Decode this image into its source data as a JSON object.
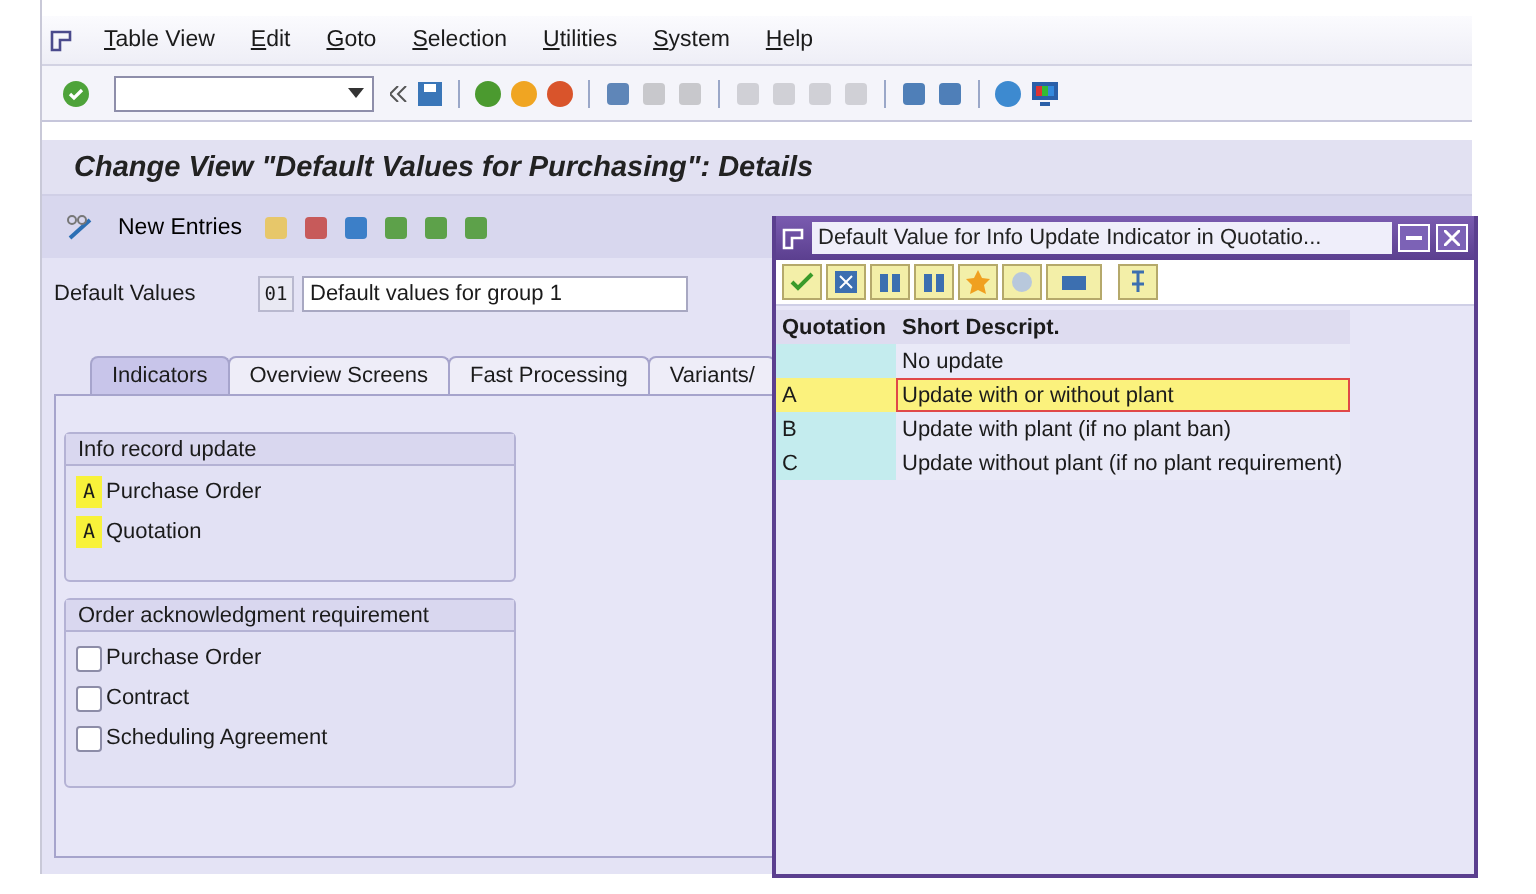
{
  "menu_bar": {
    "items": [
      "Table View",
      "Edit",
      "Goto",
      "Selection",
      "Utilities",
      "System",
      "Help"
    ]
  },
  "screen_title": "Change View \"Default Values for Purchasing\": Details",
  "app_toolbar": {
    "new_entries": "New Entries"
  },
  "default_values": {
    "label": "Default Values",
    "code": "01",
    "description": "Default values for group 1"
  },
  "tabs": [
    {
      "label": "Indicators",
      "selected": true
    },
    {
      "label": "Overview Screens",
      "selected": false
    },
    {
      "label": "Fast Processing",
      "selected": false
    },
    {
      "label": "Variants/",
      "selected": false
    }
  ],
  "groups": [
    {
      "title": "Info record update",
      "items": [
        {
          "kind": "indicator",
          "value": "A",
          "label": "Purchase Order",
          "highlighted": true
        },
        {
          "kind": "indicator",
          "value": "A",
          "label": "Quotation",
          "highlighted": true
        }
      ]
    },
    {
      "title": "Order acknowledgment requirement",
      "items": [
        {
          "kind": "checkbox",
          "checked": false,
          "label": "Purchase Order"
        },
        {
          "kind": "checkbox",
          "checked": false,
          "label": "Contract"
        },
        {
          "kind": "checkbox",
          "checked": false,
          "label": "Scheduling Agreement"
        }
      ]
    }
  ],
  "dialog": {
    "title": "Default Value for Info Update Indicator in Quotatio...",
    "columns": [
      "Quotation",
      "Short Descript."
    ],
    "rows": [
      {
        "code": "",
        "description": "No update",
        "selected": false
      },
      {
        "code": "A",
        "description": "Update with or without plant",
        "selected": true
      },
      {
        "code": "B",
        "description": "Update with plant (if no plant ban)",
        "selected": false
      },
      {
        "code": "C",
        "description": "Update without plant (if no plant requirement)",
        "selected": false
      }
    ]
  }
}
